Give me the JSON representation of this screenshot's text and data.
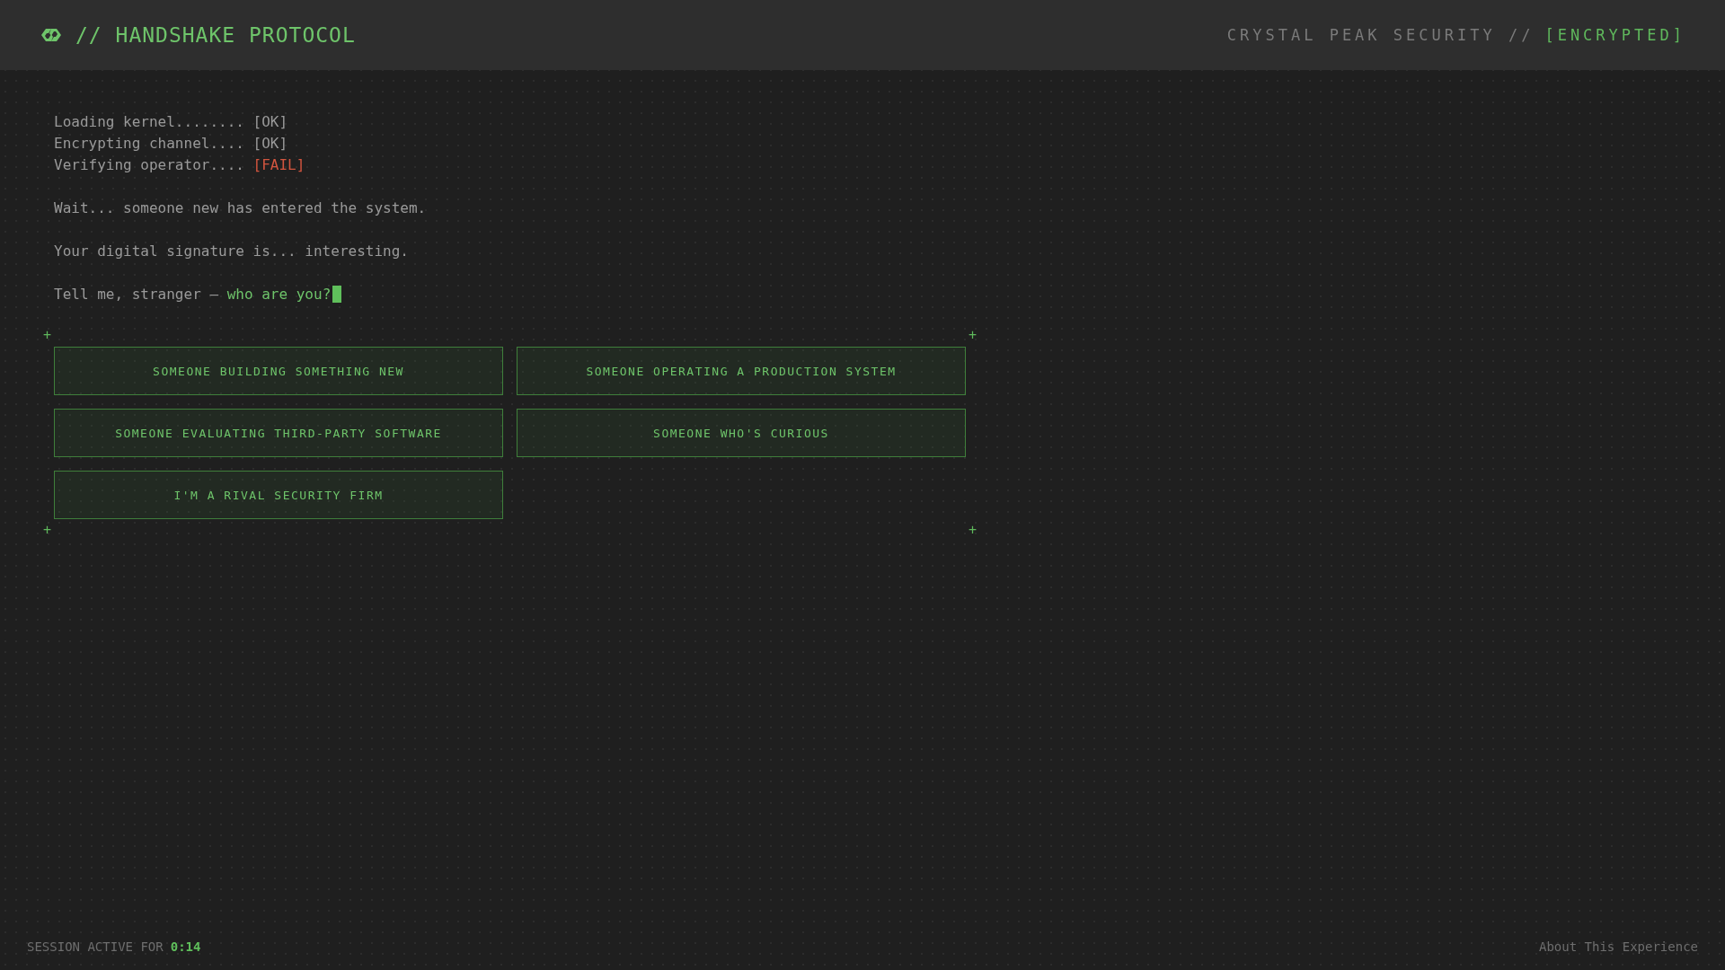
{
  "header": {
    "title": "// HANDSHAKE PROTOCOL",
    "company": "CRYSTAL PEAK SECURITY //",
    "badge": "[ENCRYPTED]"
  },
  "boot_log": [
    {
      "label": "Loading kernel........",
      "status": "[OK]",
      "kind": "ok"
    },
    {
      "label": "Encrypting channel....",
      "status": "[OK]",
      "kind": "ok"
    },
    {
      "label": "Verifying operator....",
      "status": "[FAIL]",
      "kind": "fail"
    }
  ],
  "messages": [
    "Wait... someone new has entered the system.",
    "Your digital signature is... interesting."
  ],
  "prompt": {
    "text": "Tell me, stranger –",
    "question": "who are you?"
  },
  "corner_marks": [
    "+",
    "+",
    "+",
    "+"
  ],
  "options": [
    {
      "label": "SOMEONE BUILDING SOMETHING NEW"
    },
    {
      "label": "SOMEONE OPERATING A PRODUCTION SYSTEM"
    },
    {
      "label": "SOMEONE EVALUATING THIRD-PARTY SOFTWARE"
    },
    {
      "label": "SOMEONE WHO'S CURIOUS"
    },
    {
      "label": "I'M A RIVAL SECURITY FIRM"
    }
  ],
  "footer": {
    "session_label": "SESSION ACTIVE FOR",
    "session_time": "0:14",
    "link": "About This Experience"
  }
}
